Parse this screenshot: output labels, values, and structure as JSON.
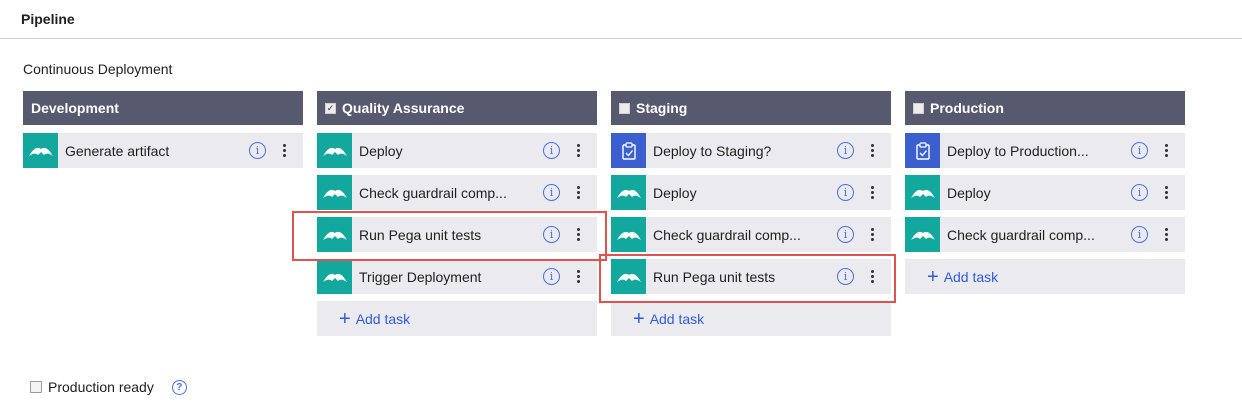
{
  "header": {
    "title": "Pipeline"
  },
  "pipeline": {
    "name": "Continuous Deployment"
  },
  "stages": [
    {
      "name": "Development",
      "has_checkbox": false,
      "checked": false,
      "tasks": [
        {
          "label": "Generate artifact",
          "icon": "pega-bird-icon",
          "icon_color": "teal"
        }
      ],
      "add_task": null
    },
    {
      "name": "Quality Assurance",
      "has_checkbox": true,
      "checked": true,
      "tasks": [
        {
          "label": "Deploy",
          "icon": "pega-bird-icon",
          "icon_color": "teal"
        },
        {
          "label": "Check guardrail comp...",
          "icon": "pega-bird-icon",
          "icon_color": "teal"
        },
        {
          "label": "Run Pega unit tests",
          "icon": "pega-bird-icon",
          "icon_color": "teal"
        },
        {
          "label": "Trigger Deployment",
          "icon": "pega-bird-icon",
          "icon_color": "teal"
        }
      ],
      "add_task": "Add task"
    },
    {
      "name": "Staging",
      "has_checkbox": true,
      "checked": false,
      "tasks": [
        {
          "label": "Deploy to Staging?",
          "icon": "clipboard-check-icon",
          "icon_color": "blue"
        },
        {
          "label": "Deploy",
          "icon": "pega-bird-icon",
          "icon_color": "teal"
        },
        {
          "label": "Check guardrail comp...",
          "icon": "pega-bird-icon",
          "icon_color": "teal"
        },
        {
          "label": "Run Pega unit tests",
          "icon": "pega-bird-icon",
          "icon_color": "teal"
        }
      ],
      "add_task": "Add task"
    },
    {
      "name": "Production",
      "has_checkbox": true,
      "checked": false,
      "tasks": [
        {
          "label": "Deploy to Production...",
          "icon": "clipboard-check-icon",
          "icon_color": "blue"
        },
        {
          "label": "Deploy",
          "icon": "pega-bird-icon",
          "icon_color": "teal"
        },
        {
          "label": "Check guardrail comp...",
          "icon": "pega-bird-icon",
          "icon_color": "teal"
        }
      ],
      "add_task": "Add task"
    }
  ],
  "footer": {
    "production_ready_label": "Production ready",
    "checked": false
  },
  "colors": {
    "stage_header": "#57596f",
    "task_bg": "#eaeaef",
    "teal": "#13a89e",
    "blue": "#3c5fcf",
    "link": "#2f5cd6",
    "highlight": "#e05252"
  }
}
